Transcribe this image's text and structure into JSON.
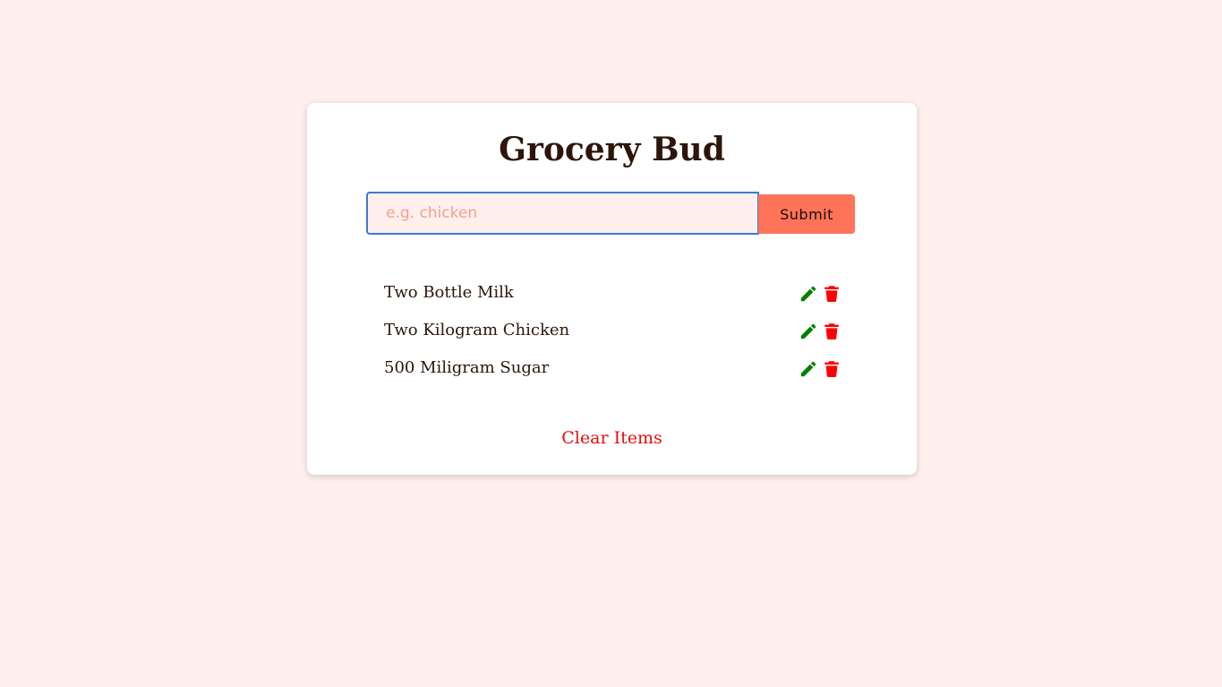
{
  "app": {
    "title": "Grocery Bud"
  },
  "form": {
    "placeholder": "e.g. chicken",
    "value": "",
    "submit_label": "Submit"
  },
  "items": [
    {
      "name": "Two Bottle Milk",
      "edit_icon": "pencil-icon",
      "delete_icon": "trash-icon"
    },
    {
      "name": "Two Kilogram Chicken",
      "edit_icon": "pencil-icon",
      "delete_icon": "trash-icon"
    },
    {
      "name": "500 Miligram Sugar",
      "edit_icon": "pencil-icon",
      "delete_icon": "trash-icon"
    }
  ],
  "clear_label": "Clear Items",
  "colors": {
    "background": "#fff0ee",
    "accent": "#ff7459",
    "edit": "#008000",
    "delete": "#ff0000",
    "clear": "#e01010",
    "title": "#2d150a"
  }
}
